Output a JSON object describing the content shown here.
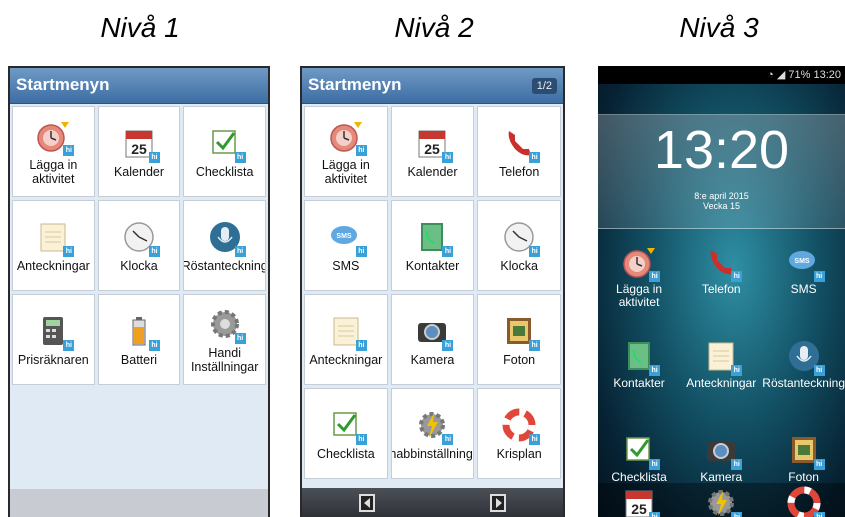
{
  "levels": [
    {
      "title": "Nivå 1"
    },
    {
      "title": "Nivå 2"
    },
    {
      "title": "Nivå 3"
    }
  ],
  "phone1": {
    "header": "Startmenyn",
    "tiles": [
      {
        "label": "Lägga in\naktivitet",
        "icon": "add-activity-icon"
      },
      {
        "label": "Kalender",
        "icon": "calendar-icon"
      },
      {
        "label": "Checklista",
        "icon": "checklist-icon"
      },
      {
        "label": "Anteckningar",
        "icon": "notes-icon"
      },
      {
        "label": "Klocka",
        "icon": "clock-icon"
      },
      {
        "label": "Röstanteckning",
        "icon": "microphone-icon"
      },
      {
        "label": "Prisräknaren",
        "icon": "calculator-icon"
      },
      {
        "label": "Batteri",
        "icon": "battery-icon"
      },
      {
        "label": "Handi\nInställningar",
        "icon": "gear-icon"
      }
    ]
  },
  "phone2": {
    "header": "Startmenyn",
    "page_indicator": "1/2",
    "tiles": [
      {
        "label": "Lägga in\naktivitet",
        "icon": "add-activity-icon"
      },
      {
        "label": "Kalender",
        "icon": "calendar-icon"
      },
      {
        "label": "Telefon",
        "icon": "phone-icon"
      },
      {
        "label": "SMS",
        "icon": "sms-icon"
      },
      {
        "label": "Kontakter",
        "icon": "contacts-icon"
      },
      {
        "label": "Klocka",
        "icon": "clock-icon"
      },
      {
        "label": "Anteckningar",
        "icon": "notes-icon"
      },
      {
        "label": "Kamera",
        "icon": "camera-icon"
      },
      {
        "label": "Foton",
        "icon": "photos-icon"
      },
      {
        "label": "Checklista",
        "icon": "checklist-icon"
      },
      {
        "label": "Snabbinställningar",
        "icon": "quick-settings-icon"
      },
      {
        "label": "Krisplan",
        "icon": "lifebuoy-icon"
      }
    ]
  },
  "phone3": {
    "status": "71% 13:20",
    "clock_time": "13:20",
    "clock_date": "8:e april 2015",
    "clock_week": "Vecka 15",
    "apps": [
      {
        "label": "Lägga in\naktivitet",
        "icon": "add-activity-icon"
      },
      {
        "label": "Telefon",
        "icon": "phone-icon"
      },
      {
        "label": "SMS",
        "icon": "sms-icon"
      },
      {
        "label": "Kontakter",
        "icon": "contacts-icon"
      },
      {
        "label": "Anteckningar",
        "icon": "notes-icon"
      },
      {
        "label": "Röstanteckning",
        "icon": "microphone-icon"
      },
      {
        "label": "Checklista",
        "icon": "checklist-icon"
      },
      {
        "label": "Kamera",
        "icon": "camera-icon"
      },
      {
        "label": "Foton",
        "icon": "photos-icon"
      }
    ],
    "page_dots": "●●",
    "dock": [
      {
        "icon": "calendar-icon"
      },
      {
        "icon": "quick-settings-icon"
      },
      {
        "icon": "lifebuoy-icon"
      }
    ]
  },
  "colors": {
    "header_blue": "#4a78ad",
    "tile_bg": "#ffffff",
    "menu_bg": "#dfeaf5",
    "hi_badge": "#3aa0d8"
  }
}
